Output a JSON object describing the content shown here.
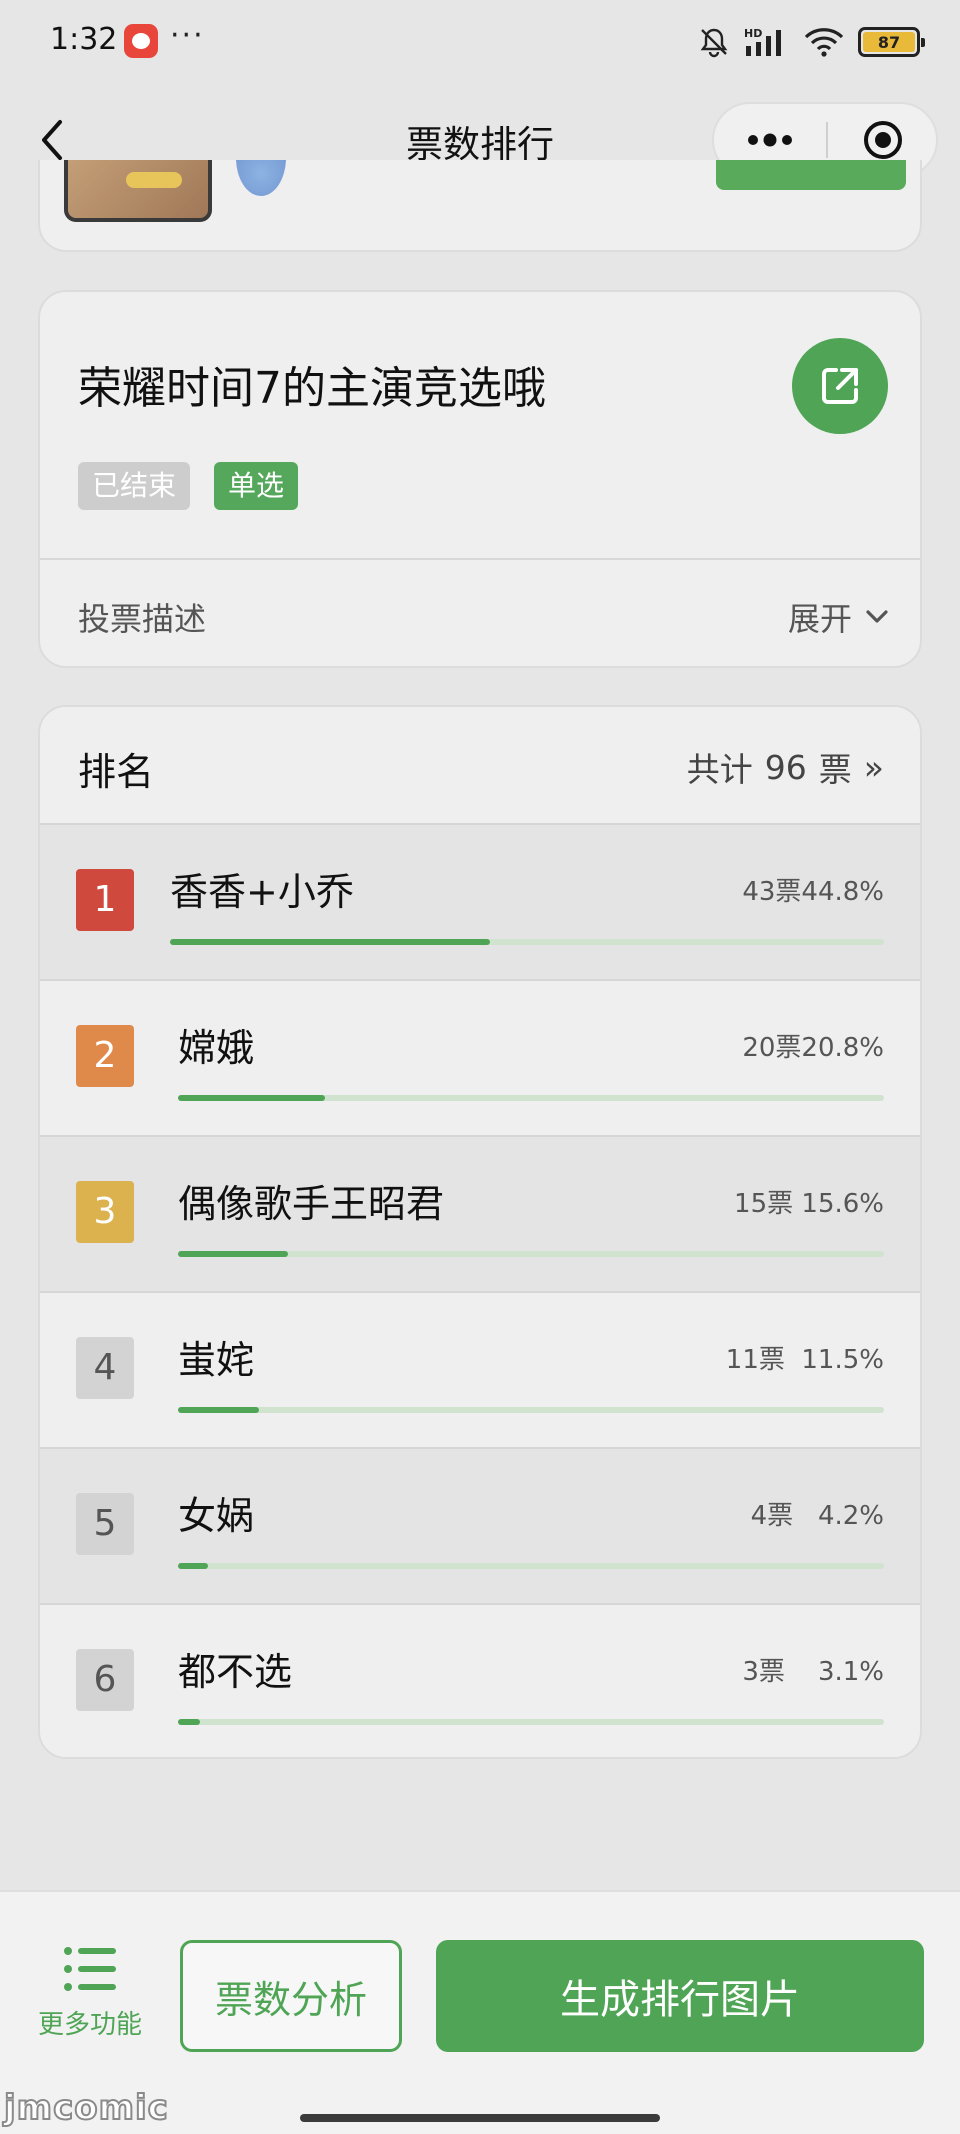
{
  "status_bar": {
    "time": "1:32",
    "dots": "···",
    "battery_level": "87",
    "icons": [
      "app-notification-icon",
      "bell-muted-icon",
      "hd-signal-icon",
      "wifi-icon",
      "battery-icon"
    ]
  },
  "nav": {
    "title": "票数排行",
    "back_icon": "chevron-left-icon",
    "more_icon": "more-dots-icon",
    "close_icon": "target-circle-icon"
  },
  "vote": {
    "title": "荣耀时间7的主演竞选哦",
    "status_tag": "已结束",
    "type_tag": "单选",
    "description_label": "投票描述",
    "expand_label": "展开",
    "share_icon": "share-external-icon"
  },
  "ranking": {
    "title": "排名",
    "total_prefix": "共计",
    "total_votes": "96",
    "total_suffix": "票",
    "total_arrow": "»",
    "items": [
      {
        "rank": "1",
        "name": "香香+小乔",
        "stats": "43票44.8%",
        "votes": 43,
        "percent": 44.8,
        "badge_color": "#d0493d"
      },
      {
        "rank": "2",
        "name": "嫦娥",
        "stats": "20票20.8%",
        "votes": 20,
        "percent": 20.8,
        "badge_color": "#df8a4a"
      },
      {
        "rank": "3",
        "name": "偶像歌手王昭君",
        "stats": "15票 15.6%",
        "votes": 15,
        "percent": 15.6,
        "badge_color": "#dcb24f"
      },
      {
        "rank": "4",
        "name": "蚩姹",
        "stats": "11票  11.5%",
        "votes": 11,
        "percent": 11.5,
        "badge_color": "#d3d3d3"
      },
      {
        "rank": "5",
        "name": "女娲",
        "stats": "4票   4.2%",
        "votes": 4,
        "percent": 4.2,
        "badge_color": "#d3d3d3"
      },
      {
        "rank": "6",
        "name": "都不选",
        "stats": "3票    3.1%",
        "votes": 3,
        "percent": 3.1,
        "badge_color": "#d3d3d3"
      }
    ]
  },
  "bottom": {
    "more_label": "更多功能",
    "analysis_label": "票数分析",
    "generate_label": "生成排行图片",
    "watermark": "jmcomic"
  },
  "colors": {
    "accent_green": "#4fa555",
    "page_background": "#e6e6e6",
    "card_background": "#efefef"
  }
}
